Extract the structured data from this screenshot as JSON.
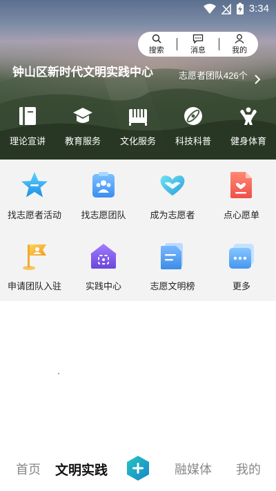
{
  "status_bar": {
    "time": "3:34"
  },
  "top_actions": [
    {
      "label": "搜索",
      "icon": "search-icon"
    },
    {
      "label": "消息",
      "icon": "message-icon"
    },
    {
      "label": "我的",
      "icon": "user-icon"
    }
  ],
  "hero": {
    "title": "钟山区新时代文明实践中心",
    "notice": "志愿者团队426个"
  },
  "hero_nav": [
    {
      "label": "理论宣讲",
      "icon": "book-icon"
    },
    {
      "label": "教育服务",
      "icon": "graduation-cap-icon"
    },
    {
      "label": "文化服务",
      "icon": "piano-icon"
    },
    {
      "label": "科技科普",
      "icon": "atom-icon"
    },
    {
      "label": "健身体育",
      "icon": "fitness-icon"
    }
  ],
  "grid": [
    {
      "label": "找志愿者活动",
      "icon": "star-icon"
    },
    {
      "label": "找志愿团队",
      "icon": "team-icon"
    },
    {
      "label": "成为志愿者",
      "icon": "heart-hands-icon"
    },
    {
      "label": "点心愿单",
      "icon": "wish-list-icon"
    },
    {
      "label": "申请团队入驻",
      "icon": "flag-icon"
    },
    {
      "label": "实践中心",
      "icon": "house-icon"
    },
    {
      "label": "志愿文明榜",
      "icon": "document-icon"
    },
    {
      "label": "更多",
      "icon": "more-icon"
    }
  ],
  "tabs": {
    "home": "首页",
    "practice": "文明实践",
    "media": "融媒体",
    "mine": "我的",
    "active": "文明实践",
    "accent_color": "#1ea8b5"
  },
  "colors": {
    "grid_bg": "#f3f3f3",
    "star_blue": "#2aa6ee",
    "team_blue": "#4a9ef6",
    "heart_teal": "#35b7e6",
    "wish_red": "#f26a5c",
    "flag_yellow": "#f5b82e",
    "house_purple": "#7c5ce6",
    "doc_blue": "#4e9ff2",
    "more_blue": "#5aa9f5"
  }
}
